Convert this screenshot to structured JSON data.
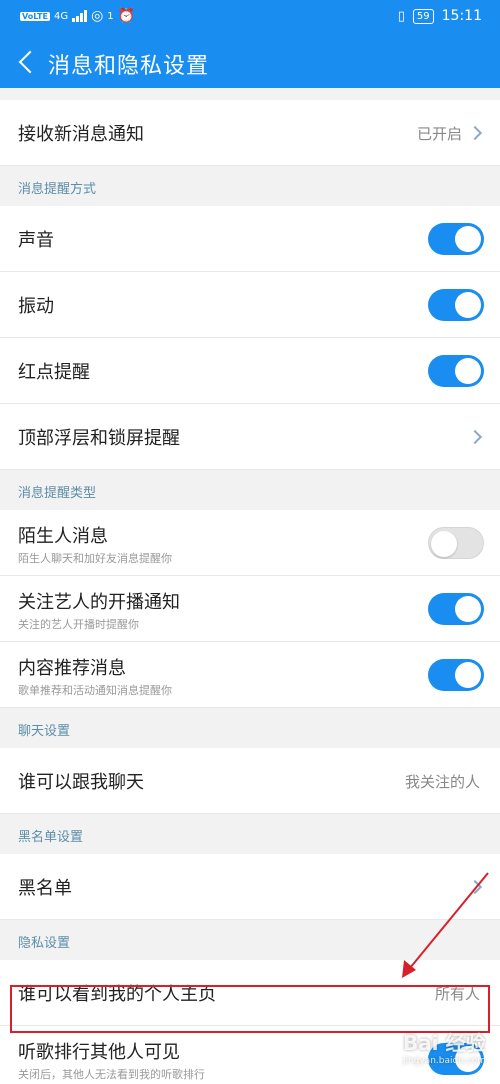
{
  "status_bar": {
    "network_tag": "VoLTE",
    "network_type": "4G",
    "hotspot_count": "1",
    "battery": "59",
    "time": "15:11"
  },
  "app_bar": {
    "title": "消息和隐私设置"
  },
  "rows": {
    "receive_notifications": {
      "label": "接收新消息通知",
      "value": "已开启"
    },
    "sound": {
      "label": "声音",
      "toggle": "on"
    },
    "vibrate": {
      "label": "振动",
      "toggle": "on"
    },
    "red_dot": {
      "label": "红点提醒",
      "toggle": "on"
    },
    "top_float": {
      "label": "顶部浮层和锁屏提醒"
    },
    "stranger": {
      "label": "陌生人消息",
      "subtext": "陌生人聊天和加好友消息提醒你",
      "toggle": "off"
    },
    "artist_live": {
      "label": "关注艺人的开播通知",
      "subtext": "关注的艺人开播时提醒你",
      "toggle": "on"
    },
    "recommend": {
      "label": "内容推荐消息",
      "subtext": "歌单推荐和活动通知消息提醒你",
      "toggle": "on"
    },
    "who_can_chat": {
      "label": "谁可以跟我聊天",
      "value": "我关注的人"
    },
    "blacklist": {
      "label": "黑名单"
    },
    "who_can_view_profile": {
      "label": "谁可以看到我的个人主页",
      "value": "所有人"
    },
    "ranking_visible": {
      "label": "听歌排行其他人可见",
      "subtext": "关闭后，其他人无法看到我的听歌排行",
      "toggle": "on"
    }
  },
  "sections": {
    "reminder_method": "消息提醒方式",
    "reminder_type": "消息提醒类型",
    "chat_settings": "聊天设置",
    "blacklist_settings": "黑名单设置",
    "privacy_settings": "隐私设置"
  },
  "watermark": {
    "brand": "Bai 经验",
    "url": "jingyan.baidu.com"
  },
  "colors": {
    "accent": "#1a8ef0",
    "annotation": "#d8202a"
  }
}
